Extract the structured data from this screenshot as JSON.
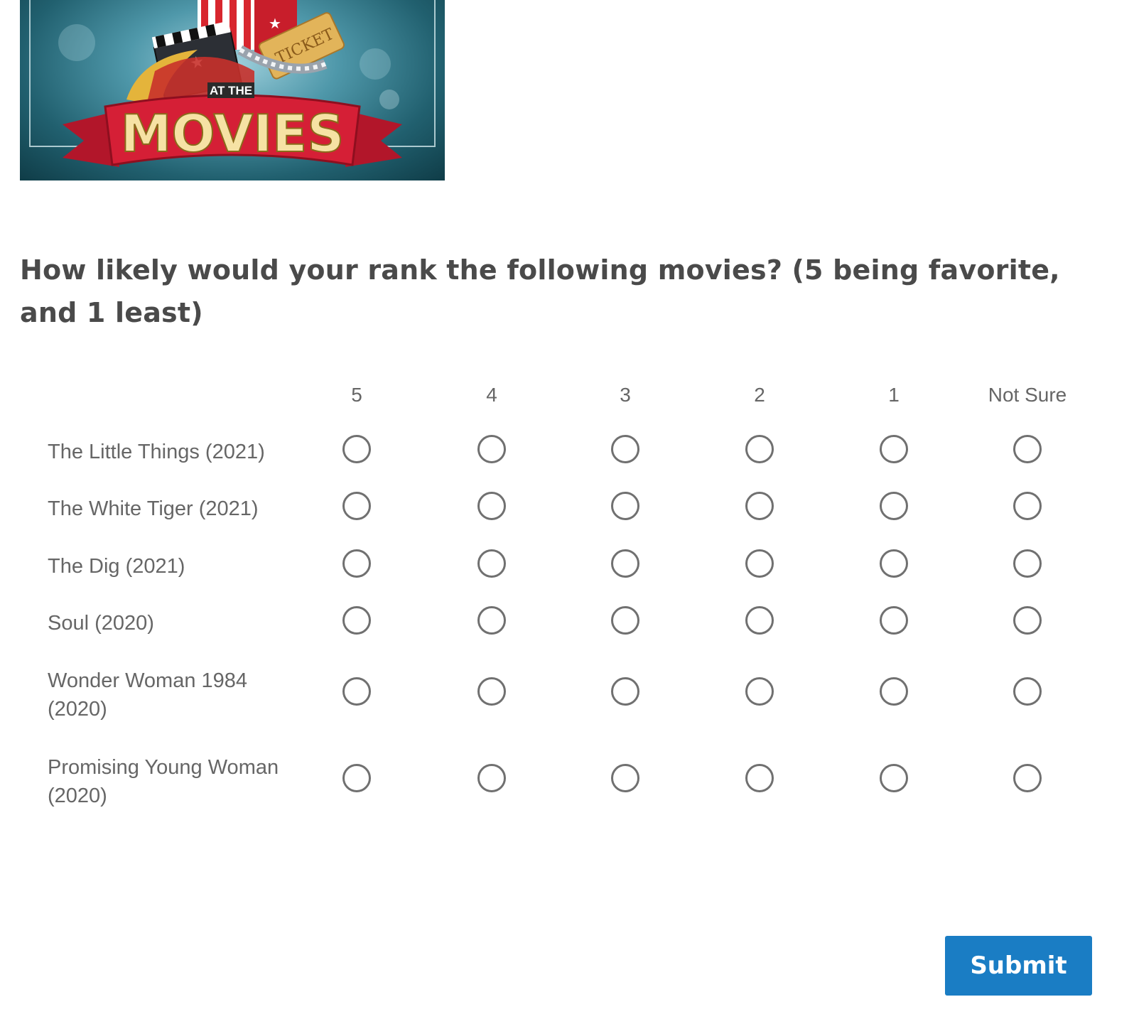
{
  "banner": {
    "small_text": "AT THE",
    "big_text": "MOVIES",
    "ticket_text": "TICKET"
  },
  "question": "How likely would your rank the following movies?  (5 being favorite, and 1 least)",
  "matrix": {
    "columns": [
      "5",
      "4",
      "3",
      "2",
      "1",
      "Not Sure"
    ],
    "rows": [
      "The Little Things (2021)",
      "The White Tiger (2021)",
      "The Dig (2021)",
      "Soul (2020)",
      "Wonder Woman 1984 (2020)",
      "Promising Young Woman (2020)"
    ]
  },
  "submit_label": "Submit",
  "colors": {
    "accent": "#1a7dc4",
    "text": "#4a4a4a",
    "muted": "#666666",
    "radio_border": "#707070"
  }
}
